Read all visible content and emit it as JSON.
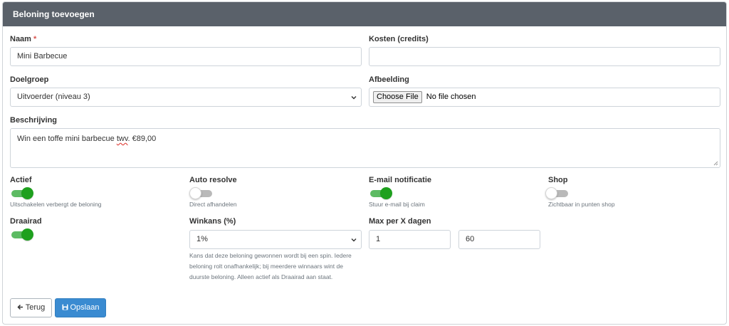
{
  "panel": {
    "title": "Beloning toevoegen"
  },
  "form": {
    "naam": {
      "label": "Naam",
      "required_mark": "*",
      "value": "Mini Barbecue"
    },
    "kosten": {
      "label": "Kosten (credits)",
      "value": ""
    },
    "doelgroep": {
      "label": "Doelgroep",
      "value": "Uitvoerder (niveau 3)"
    },
    "afbeelding": {
      "label": "Afbeelding",
      "button": "Choose File",
      "status": "No file chosen"
    },
    "beschrijving": {
      "label": "Beschrijving",
      "value_before": "Win een toffe mini barbecue ",
      "value_flagged": "twv",
      "value_after": ". €89,00"
    }
  },
  "toggles": {
    "actief": {
      "label": "Actief",
      "hint": "Uitschakelen verbergt de beloning",
      "on": true
    },
    "auto_resolve": {
      "label": "Auto resolve",
      "hint": "Direct afhandelen",
      "on": false
    },
    "email": {
      "label": "E-mail notificatie",
      "hint": "Stuur e-mail bij claim",
      "on": true
    },
    "shop": {
      "label": "Shop",
      "hint": "Zichtbaar in punten shop",
      "on": false
    },
    "draairad": {
      "label": "Draairad",
      "on": true
    }
  },
  "winkans": {
    "label": "Winkans (%)",
    "value": "1%",
    "help": "Kans dat deze beloning gewonnen wordt bij een spin. Iedere beloning rolt onafhankelijk; bij meerdere winnaars wint de duurste beloning. Alleen actief als Draairad aan staat."
  },
  "max_per": {
    "label": "Max per X dagen",
    "max_value": "1",
    "days_value": "60"
  },
  "buttons": {
    "back": "Terug",
    "save": "Opslaan"
  },
  "colors": {
    "header": "#5a616a",
    "toggle_on": "#1ea01e",
    "primary": "#3a8bd1",
    "required": "#d9534f"
  },
  "icons": {
    "back": "arrow-left-icon",
    "save": "floppy-disk-icon",
    "select": "chevron-down-icon"
  }
}
